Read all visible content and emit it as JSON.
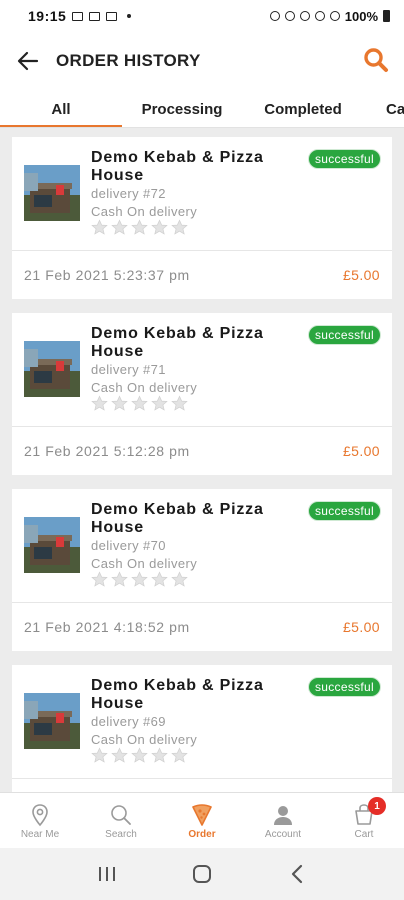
{
  "status_bar": {
    "time": "19:15",
    "battery": "100%"
  },
  "header": {
    "title": "ORDER HISTORY",
    "back_icon": "arrow-left-icon",
    "search_icon": "search-icon"
  },
  "colors": {
    "accent": "#e8772e",
    "success": "#2aa63f",
    "badge_red": "#e52d27"
  },
  "tabs": [
    {
      "label": "All",
      "active": true
    },
    {
      "label": "Processing",
      "active": false
    },
    {
      "label": "Completed",
      "active": false
    },
    {
      "label": "Ca",
      "active": false
    }
  ],
  "orders": [
    {
      "store": "Demo Kebab & Pizza House",
      "status": "successful",
      "delivery": "delivery #72",
      "payment": "Cash On delivery",
      "rating": 0,
      "date": "21 Feb 2021 5:23:37 pm",
      "price": "£5.00"
    },
    {
      "store": "Demo Kebab & Pizza House",
      "status": "successful",
      "delivery": "delivery #71",
      "payment": "Cash On delivery",
      "rating": 0,
      "date": "21 Feb 2021 5:12:28 pm",
      "price": "£5.00"
    },
    {
      "store": "Demo Kebab & Pizza House",
      "status": "successful",
      "delivery": "delivery #70",
      "payment": "Cash On delivery",
      "rating": 0,
      "date": "21 Feb 2021 4:18:52 pm",
      "price": "£5.00"
    },
    {
      "store": "Demo Kebab & Pizza House",
      "status": "successful",
      "delivery": "delivery #69",
      "payment": "Cash On delivery",
      "rating": 0,
      "date": "",
      "price": ""
    }
  ],
  "bottom_nav": [
    {
      "label": "Near Me",
      "icon": "location-pin-icon",
      "active": false
    },
    {
      "label": "Search",
      "icon": "search-icon",
      "active": false
    },
    {
      "label": "Order",
      "icon": "pizza-slice-icon",
      "active": true
    },
    {
      "label": "Account",
      "icon": "user-icon",
      "active": false
    },
    {
      "label": "Cart",
      "icon": "cart-icon",
      "active": false,
      "badge": "1"
    }
  ],
  "system_nav": {
    "recents": "recents-icon",
    "home": "home-icon",
    "back": "back-chevron-icon"
  }
}
